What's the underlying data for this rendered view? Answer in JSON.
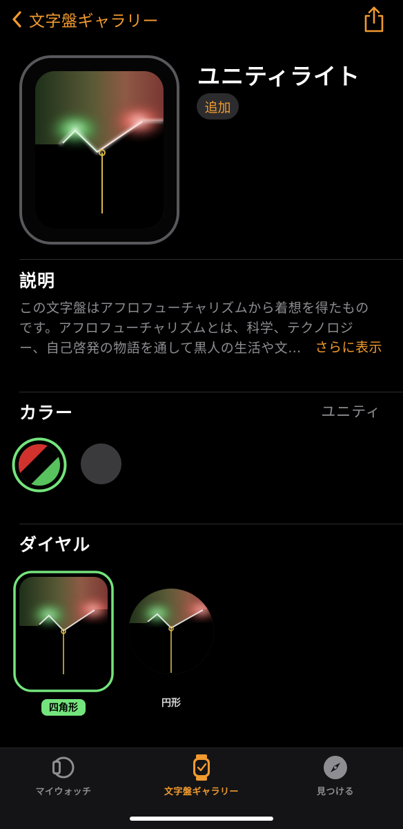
{
  "nav": {
    "back_label": "文字盤ギャラリー",
    "back_icon": "chevron-left-icon",
    "share_icon": "share-icon"
  },
  "face": {
    "title": "ユニティライト",
    "add_label": "追加"
  },
  "description": {
    "heading": "説明",
    "lines": [
      "この文字盤はアフロフューチャリズムから着想を得たもの",
      "です。アフロフューチャリズムとは、科学、テクノロジ",
      "ー、自己啓発の物語を通して黒人の生活や文…"
    ],
    "more_label": "さらに表示"
  },
  "color": {
    "heading": "カラー",
    "selected_value": "ユニティ",
    "options": [
      {
        "name": "unity",
        "colors": [
          "#d2322d",
          "#000000",
          "#58c25e"
        ],
        "selected": true
      },
      {
        "name": "gray",
        "colors": [
          "#3a3a3c"
        ],
        "selected": false
      }
    ]
  },
  "dial": {
    "heading": "ダイヤル",
    "options": [
      {
        "label": "四角形",
        "selected": true
      },
      {
        "label": "円形",
        "selected": false
      }
    ]
  },
  "tabs": [
    {
      "label": "マイウォッチ",
      "icon": "watch-icon",
      "active": false
    },
    {
      "label": "文字盤ギャラリー",
      "icon": "watch-face-gallery-icon",
      "active": true
    },
    {
      "label": "見つける",
      "icon": "compass-icon",
      "active": false
    }
  ],
  "colors": {
    "accent": "#f19a2f",
    "selected_green": "#74e47c",
    "secondary_text": "#8d8d92",
    "background": "#000000"
  }
}
